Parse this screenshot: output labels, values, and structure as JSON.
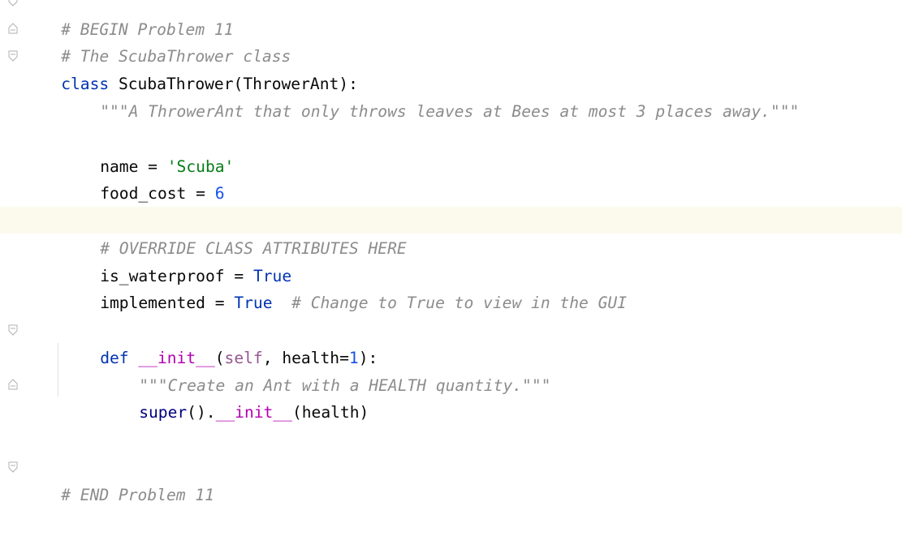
{
  "editor": {
    "lines": {
      "l0": {
        "comment": "# BEGIN Problem 11"
      },
      "l1": {
        "comment": "# The ScubaThrower class"
      },
      "l2": {
        "kw": "class",
        "name": " ScubaThrower(ThrowerAnt):"
      },
      "l3": {
        "doc": "\"\"\"A ThrowerAnt that only throws leaves at Bees at most 3 places away.\"\"\""
      },
      "l5": {
        "lhs": "name = ",
        "str": "'Scuba'"
      },
      "l6": {
        "lhs": "food_cost = ",
        "num": "6"
      },
      "l8": {
        "comment": "# OVERRIDE CLASS ATTRIBUTES HERE"
      },
      "l9": {
        "lhs": "is_waterproof = ",
        "val": "True"
      },
      "l10": {
        "lhs": "implemented = ",
        "val": "True",
        "comment": "  # Change to True to view in the GUI"
      },
      "l12": {
        "kw": "def",
        "sp": " ",
        "fn": "__init__",
        "p1": "(",
        "self": "self",
        "p2": ", health=",
        "num": "1",
        "p3": "):"
      },
      "l13": {
        "doc": "\"\"\"Create an Ant with a HEALTH quantity.\"\"\""
      },
      "l14": {
        "bi": "super",
        "p1": "().",
        "fn": "__init__",
        "p2": "(health)"
      },
      "l17": {
        "comment": "# END Problem 11"
      }
    }
  }
}
